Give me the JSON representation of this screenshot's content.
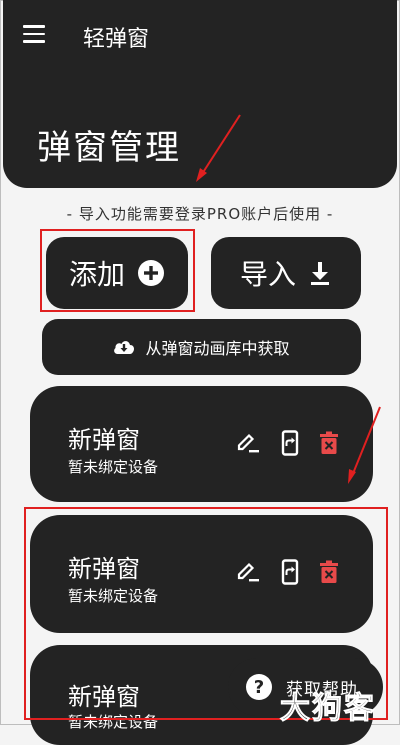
{
  "app": {
    "title": "轻弹窗"
  },
  "header": {
    "page_title": "弹窗管理"
  },
  "notice": "- 导入功能需要登录PRO账户后使用 -",
  "actions": {
    "add_label": "添加",
    "import_label": "导入",
    "gallery_label": "从弹窗动画库中获取"
  },
  "cards": [
    {
      "title": "新弹窗",
      "subtitle": "暂未绑定设备"
    },
    {
      "title": "新弹窗",
      "subtitle": "暂未绑定设备"
    },
    {
      "title": "新弹窗",
      "subtitle": "暂未绑定设备"
    }
  ],
  "help": {
    "label": "获取帮助"
  },
  "watermark": {
    "text": "大狗客"
  },
  "colors": {
    "dark": "#232323",
    "delete": "#e84a4a",
    "annotation": "#e02020",
    "background": "#f4f4f4"
  },
  "icons": [
    "menu-icon",
    "plus-circle-icon",
    "download-icon",
    "cloud-download-icon",
    "edit-icon",
    "phone-sync-icon",
    "trash-icon",
    "help-icon"
  ]
}
